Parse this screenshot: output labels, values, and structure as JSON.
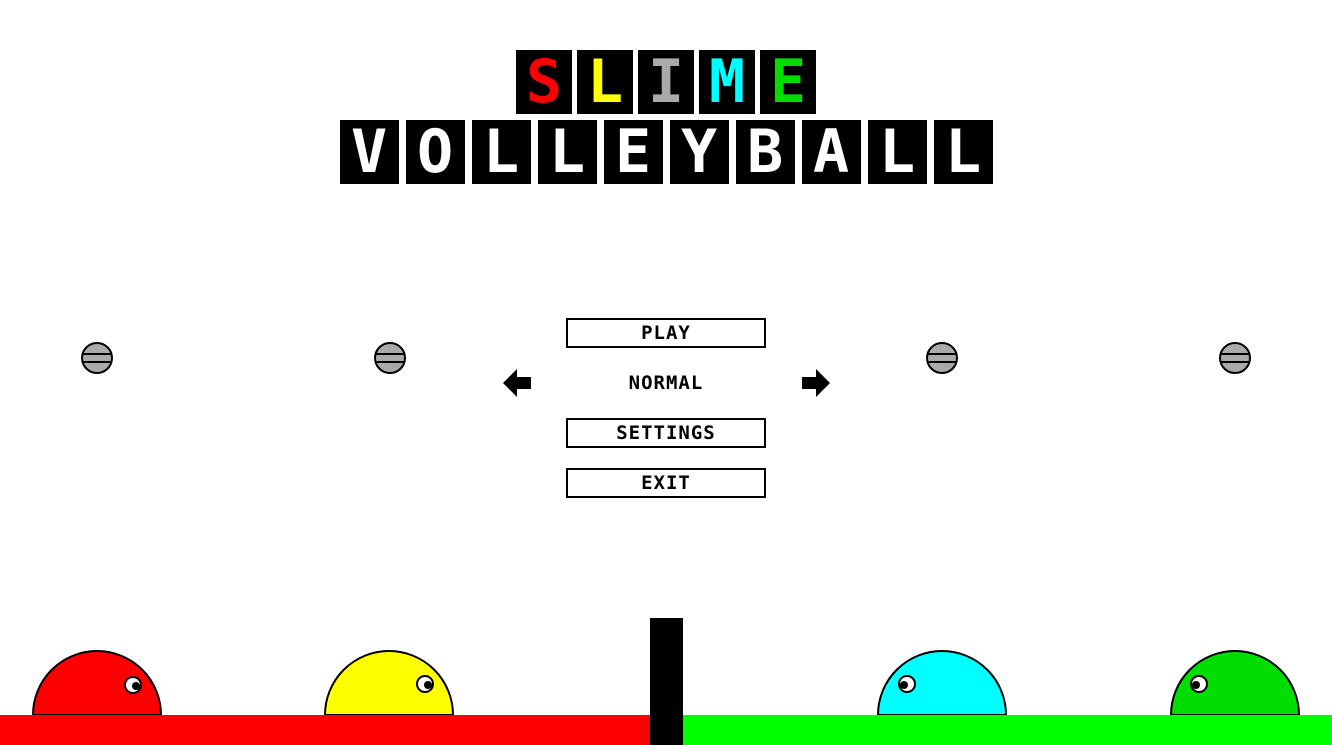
{
  "title": {
    "word1": [
      {
        "letter": "S",
        "color": "#ff0000"
      },
      {
        "letter": "L",
        "color": "#ffff00"
      },
      {
        "letter": "I",
        "color": "#aaaaaa"
      },
      {
        "letter": "M",
        "color": "#00ffff"
      },
      {
        "letter": "E",
        "color": "#00dd00"
      }
    ],
    "word2": [
      "V",
      "O",
      "L",
      "L",
      "E",
      "Y",
      "B",
      "A",
      "L",
      "L"
    ]
  },
  "menu": {
    "play_label": "PLAY",
    "mode_label": "NORMAL",
    "settings_label": "SETTINGS",
    "exit_label": "EXIT",
    "prev_mode_icon": "arrow-left-icon",
    "next_mode_icon": "arrow-right-icon"
  },
  "players": [
    {
      "color": "#ff0000",
      "side": "left",
      "facing": "right"
    },
    {
      "color": "#ffff00",
      "side": "left",
      "facing": "right"
    },
    {
      "color": "#00ffff",
      "side": "right",
      "facing": "left"
    },
    {
      "color": "#00dd00",
      "side": "right",
      "facing": "left"
    }
  ],
  "balls": {
    "count": 4,
    "color": "#aaaaaa",
    "icon": "volleyball-icon"
  },
  "court": {
    "left_color": "#ff0000",
    "right_color": "#00ff00",
    "net_color": "#000000"
  }
}
